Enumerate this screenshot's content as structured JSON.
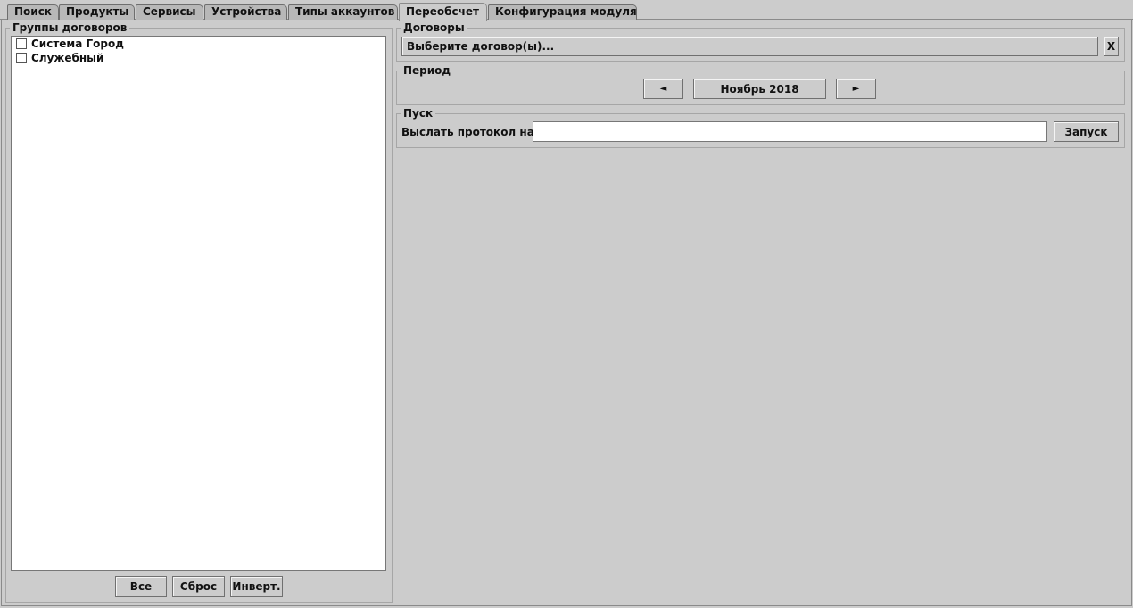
{
  "tabs": [
    {
      "label": "Поиск"
    },
    {
      "label": "Продукты"
    },
    {
      "label": "Сервисы"
    },
    {
      "label": "Устройства"
    },
    {
      "label": "Типы аккаунтов"
    },
    {
      "label": "Переобсчет",
      "active": true
    },
    {
      "label": "Конфигурация модуля"
    }
  ],
  "groups": {
    "title": "Группы договоров",
    "items": [
      {
        "label": "Система Город",
        "checked": false
      },
      {
        "label": "Служебный",
        "checked": false
      }
    ],
    "buttons": {
      "all": "Все",
      "reset": "Сброс",
      "invert": "Инверт."
    }
  },
  "contracts": {
    "title": "Договоры",
    "select_label": "Выберите договор(ы)...",
    "clear_label": "X"
  },
  "period": {
    "title": "Период",
    "prev_label": "◄",
    "value": "Ноябрь 2018",
    "next_label": "►"
  },
  "launch": {
    "title": "Пуск",
    "send_label": "Выслать протокол на:",
    "email_value": "",
    "run_label": "Запуск"
  }
}
